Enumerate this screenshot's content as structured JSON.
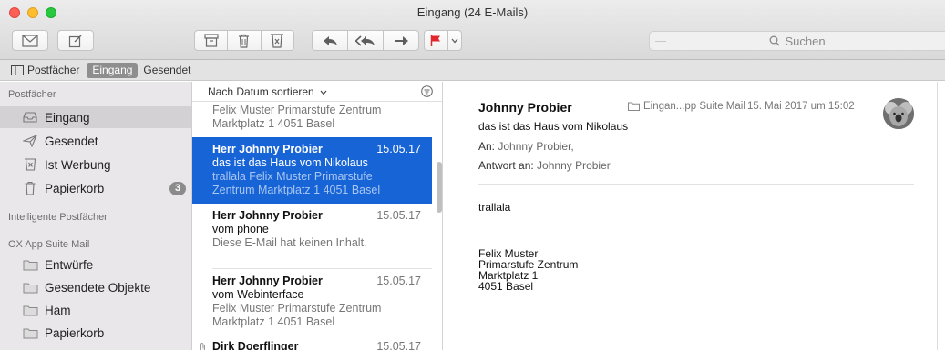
{
  "window": {
    "title": "Eingang (24 E-Mails)"
  },
  "toolbar": {
    "search_placeholder": "Suchen",
    "icons": [
      "get-mail-icon",
      "compose-icon",
      "archive-icon",
      "trash-icon",
      "junk-icon",
      "reply-icon",
      "reply-all-icon",
      "forward-icon",
      "flag-icon",
      "flag-menu-icon"
    ],
    "flag_color": "#e3262b"
  },
  "favorites": {
    "items": [
      {
        "label": "Postfächer"
      },
      {
        "label": "Eingang"
      },
      {
        "label": "Gesendet"
      }
    ]
  },
  "sidebar": {
    "section_mailboxes": "Postfächer",
    "mailboxes": [
      {
        "label": "Eingang",
        "icon": "inbox-icon"
      },
      {
        "label": "Gesendet",
        "icon": "sent-icon"
      },
      {
        "label": "Ist Werbung",
        "icon": "junk-icon"
      },
      {
        "label": "Papierkorb",
        "icon": "trash-icon",
        "badge": "3"
      }
    ],
    "section_smart": "Intelligente Postfächer",
    "section_account": "OX App Suite Mail",
    "account_folders": [
      {
        "label": "Entwürfe"
      },
      {
        "label": "Gesendete Objekte"
      },
      {
        "label": "Ham"
      },
      {
        "label": "Papierkorb"
      }
    ]
  },
  "list": {
    "sort_label": "Nach Datum sortieren",
    "partial_top": {
      "line1": "Felix Muster Primarstufe Zentrum",
      "line2": "Marktplatz 1 4051 Basel"
    },
    "messages": [
      {
        "sender": "Herr Johnny Probier",
        "date": "15.05.17",
        "subject": "das ist das Haus vom Nikolaus",
        "preview1": "trallala Felix Muster Primarstufe",
        "preview2": "Zentrum Marktplatz 1 4051 Basel"
      },
      {
        "sender": "Herr Johnny Probier",
        "date": "15.05.17",
        "subject": "vom phone",
        "preview1": "Diese E-Mail hat keinen Inhalt."
      },
      {
        "sender": "Herr Johnny Probier",
        "date": "15.05.17",
        "subject": "vom Webinterface",
        "preview1": "Felix Muster Primarstufe Zentrum",
        "preview2": "Marktplatz 1 4051 Basel"
      },
      {
        "sender": "Dirk Doerflinger",
        "date": "15.05.17"
      }
    ],
    "selection_color": "#1764d7"
  },
  "reader": {
    "from": "Johnny Probier",
    "folder": "Eingan...pp Suite Mail",
    "date": "15. Mai 2017 um 15:02",
    "subject": "das ist das Haus vom Nikolaus",
    "to_label": "An:",
    "to_value": "Johnny Probier,",
    "reply_label": "Antwort an:",
    "reply_value": "Johnny Probier",
    "body": "trallala",
    "signature": [
      "Felix Muster",
      "Primarstufe Zentrum",
      "Marktplatz 1",
      "4051 Basel"
    ]
  }
}
